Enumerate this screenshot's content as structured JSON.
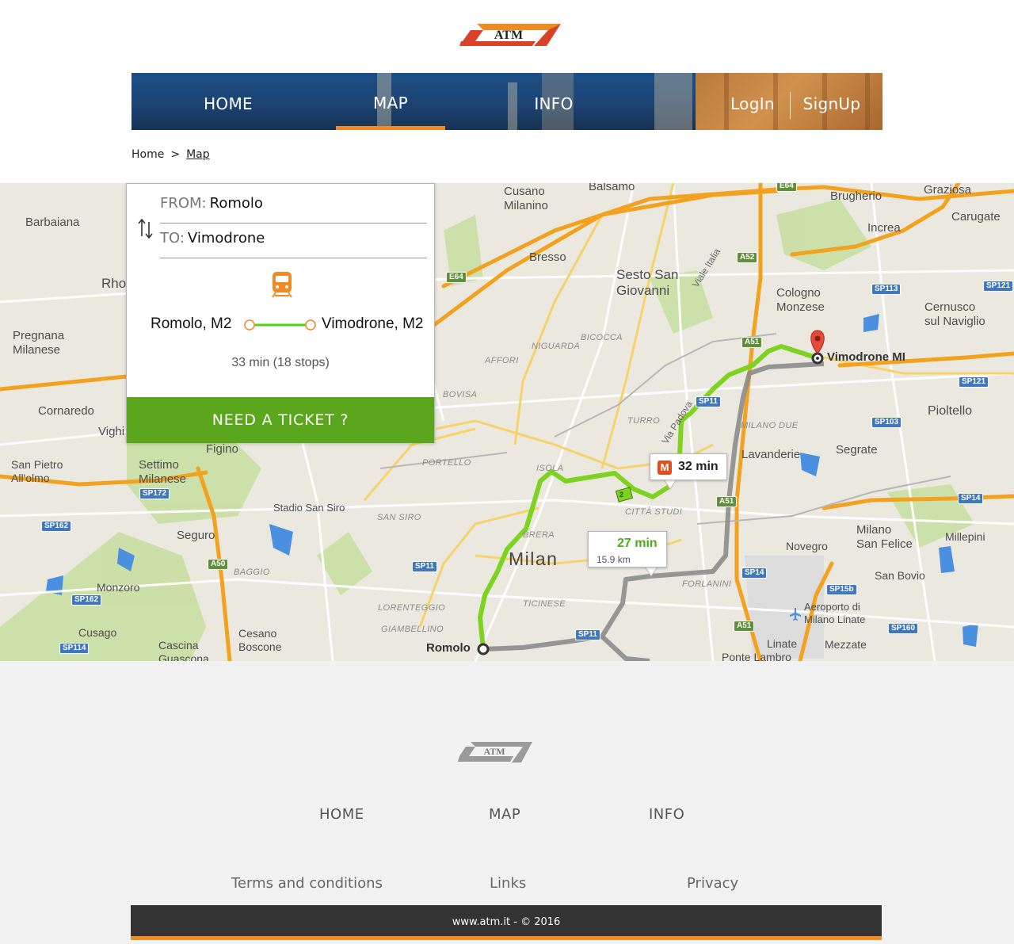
{
  "brand": {
    "logo_text": "ATM",
    "accent_color": "#f08a24",
    "logo_red": "#d9412b",
    "nav_blue": "#1d4373",
    "ticket_green": "#5aa61c"
  },
  "nav": {
    "items": [
      {
        "label": "HOME",
        "active": false
      },
      {
        "label": "MAP",
        "active": true
      },
      {
        "label": "INFO",
        "active": false
      }
    ],
    "login": "LogIn",
    "signup": "SignUp"
  },
  "breadcrumb": {
    "home": "Home",
    "separator": ">",
    "current": "Map"
  },
  "route_panel": {
    "from_label": "FROM:",
    "from_value": "Romolo",
    "to_label": "TO:",
    "to_value": "Vimodrone",
    "swap_icon": "swap-vertical-arrows-icon",
    "mode_icon": "train-icon",
    "start_stop": "Romolo, M2",
    "end_stop": "Vimodrone, M2",
    "summary": "33 min (18 stops)",
    "ticket_button": "NEED A TICKET ?"
  },
  "map": {
    "city_label": "Milan",
    "origin_label": "Romolo",
    "destination_label": "Vimodrone MI",
    "metro_time": "32 min",
    "metro_badge": "M",
    "car_time": "27 min",
    "car_distance": "15.9 km",
    "route_line_badge": "2",
    "towns": [
      "Cusano Milanino",
      "Balsamo",
      "Brugherio",
      "Graziosa",
      "Carugate",
      "Increa",
      "Barbaiana",
      "Bresso",
      "Sesto San Giovanni",
      "Cologno Monzese",
      "Cernusco sul Naviglio",
      "Pregnana Milanese",
      "Rho",
      "Vimodrone MI",
      "Cornaredo",
      "Vighi",
      "Pioltello",
      "Figino",
      "Settimo Milanese",
      "San Pietro All'olmo",
      "Lavanderie",
      "Segrate",
      "Stadio San Siro",
      "Seguro",
      "Milano San Felice",
      "Millepini",
      "Novegro",
      "San Bovio",
      "Monzoro",
      "Aeroporto di Milano Linate",
      "Cusago",
      "Cesano Boscone",
      "Cascina Guascona",
      "Linate",
      "Mezzate",
      "Ponte Lambro"
    ],
    "districts": [
      "NIGUARDA",
      "BICOCCA",
      "AFFORI",
      "BOVISA",
      "TURRO",
      "MILANO DUE",
      "PORTELLO",
      "ISOLA",
      "SAN SIRO",
      "CITTÀ STUDI",
      "BRERA",
      "BAGGIO",
      "LORENTEGGIO",
      "TICINESE",
      "GIAMBELLINO",
      "FORLANINI"
    ],
    "roads": [
      "E64",
      "A52",
      "SP113",
      "SP121",
      "A51",
      "SP11",
      "SP103",
      "SP14",
      "SP172",
      "SP162",
      "A50",
      "SP162",
      "SP114",
      "SP15b",
      "SP160",
      "Via Padova",
      "Viale Italia",
      "E64"
    ],
    "colors": {
      "transit_route": "#7ed321",
      "car_route": "#8c8c8c",
      "highway": "#f3a21f",
      "park": "#c7dea0",
      "water": "#4a8fe0"
    }
  },
  "footer": {
    "nav": [
      "HOME",
      "MAP",
      "INFO"
    ],
    "links": [
      "Terms and conditions",
      "Links",
      "Privacy"
    ],
    "copyright": "www.atm.it - © 2016"
  }
}
